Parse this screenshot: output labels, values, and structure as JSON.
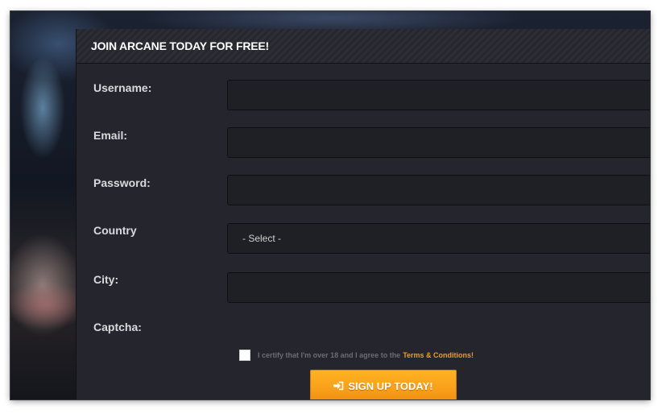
{
  "panel": {
    "title": "JOIN ARCANE TODAY FOR FREE!"
  },
  "form": {
    "username_label": "Username:",
    "username_value": "",
    "email_label": "Email:",
    "email_value": "",
    "password_label": "Password:",
    "password_value": "",
    "country_label": "Country",
    "country_selected": "- Select -",
    "city_label": "City:",
    "city_value": "",
    "captcha_label": "Captcha:",
    "terms_text": "I certify that I'm over 18 and I agree to the",
    "terms_link": "Terms & Conditions!",
    "terms_checked": false,
    "submit_label": "SIGN UP TODAY!"
  },
  "icons": {
    "submit": "sign-in-icon"
  },
  "colors": {
    "accent": "#f9a01a",
    "link": "#f39c1a",
    "panel_bg": "#25252e",
    "field_bg": "#1f1f26"
  }
}
